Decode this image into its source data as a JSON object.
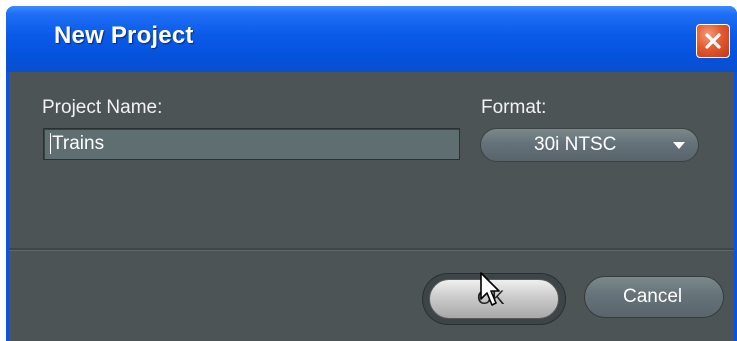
{
  "dialog": {
    "title": "New Project",
    "close_icon": "close-icon"
  },
  "form": {
    "project_name_label": "Project Name:",
    "project_name_value": "Trains",
    "format_label": "Format:",
    "format_value": "30i NTSC"
  },
  "buttons": {
    "ok_label": "OK",
    "cancel_label": "Cancel"
  },
  "colors": {
    "titlebar": "#0a5ae8",
    "panel": "#4d5456",
    "close": "#e25a2e"
  }
}
